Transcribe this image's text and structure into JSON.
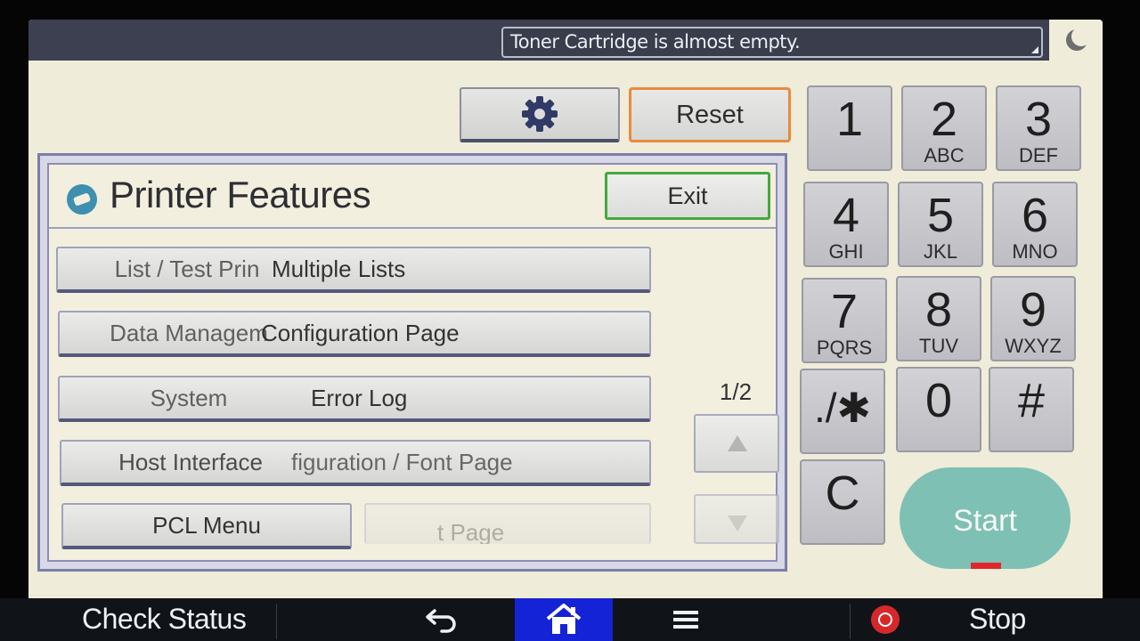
{
  "status": {
    "message": "Toner Cartridge is almost empty."
  },
  "toolbar": {
    "settings_icon": "gear-icon",
    "reset_label": "Reset"
  },
  "panel": {
    "title": "Printer Features",
    "exit_label": "Exit",
    "page_indicator": "1/2",
    "menu_items": [
      {
        "left": "List / Test Prin",
        "right": "Multiple Lists"
      },
      {
        "left": "Data Managem",
        "right": "Configuration Page"
      },
      {
        "left": "System",
        "right": "Error Log"
      },
      {
        "left": "Host Interface",
        "right": "figuration / Font Page"
      },
      {
        "left": "PCL Menu",
        "right": "t Page"
      }
    ]
  },
  "keypad": {
    "keys": [
      {
        "digit": "1",
        "letters": ""
      },
      {
        "digit": "2",
        "letters": "ABC"
      },
      {
        "digit": "3",
        "letters": "DEF"
      },
      {
        "digit": "4",
        "letters": "GHI"
      },
      {
        "digit": "5",
        "letters": "JKL"
      },
      {
        "digit": "6",
        "letters": "MNO"
      },
      {
        "digit": "7",
        "letters": "PQRS"
      },
      {
        "digit": "8",
        "letters": "TUV"
      },
      {
        "digit": "9",
        "letters": "WXYZ"
      },
      {
        "digit": "./✱",
        "letters": ""
      },
      {
        "digit": "0",
        "letters": ""
      },
      {
        "digit": "#",
        "letters": ""
      },
      {
        "digit": "C",
        "letters": ""
      }
    ],
    "start_label": "Start"
  },
  "bottom_bar": {
    "check_status_label": "Check Status",
    "back_icon": "back-arrow-icon",
    "home_icon": "home-icon",
    "menu_icon": "hamburger-menu-icon",
    "stop_label": "Stop"
  },
  "colors": {
    "reset_border": "#e98a3c",
    "exit_border": "#45a83e",
    "start_button": "#7ec0b4",
    "home_highlight": "#1523d6",
    "stop_icon": "#d6282a"
  }
}
